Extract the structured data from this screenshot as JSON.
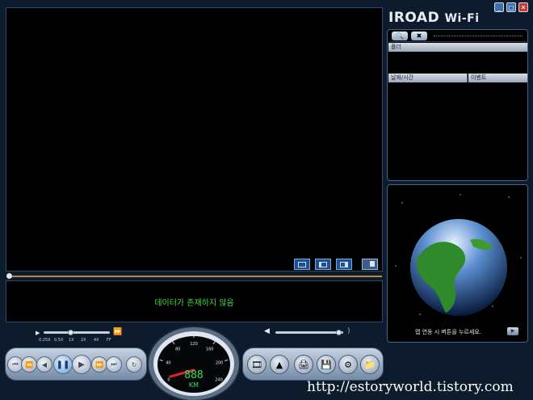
{
  "app": {
    "brand": "IROAD",
    "brand_suffix": "Wi-Fi"
  },
  "window": {
    "minimize": "_",
    "maximize": "□",
    "close": "✕"
  },
  "status": {
    "message": "데이터가 존재하지 않음"
  },
  "speeds": [
    "0.25X",
    "0.5X",
    "1X",
    "2X",
    "4X",
    "FF"
  ],
  "speedometer": {
    "ticks": [
      "0",
      "40",
      "80",
      "120",
      "160",
      "200",
      "240"
    ],
    "digits": "888",
    "unit": "KM",
    "value": 0
  },
  "panel": {
    "folder_header": "폴더",
    "col_datetime": "날짜/시간",
    "col_event": "이벤트"
  },
  "map": {
    "prompt": "맵 연동 시 버튼을 누르세요."
  },
  "watermark": "http://estoryworld.tistory.com",
  "colors": {
    "status_text": "#3fd93f",
    "accent": "#b8893a",
    "speed_needle": "#e0202a",
    "lcd": "#2fe05a"
  }
}
